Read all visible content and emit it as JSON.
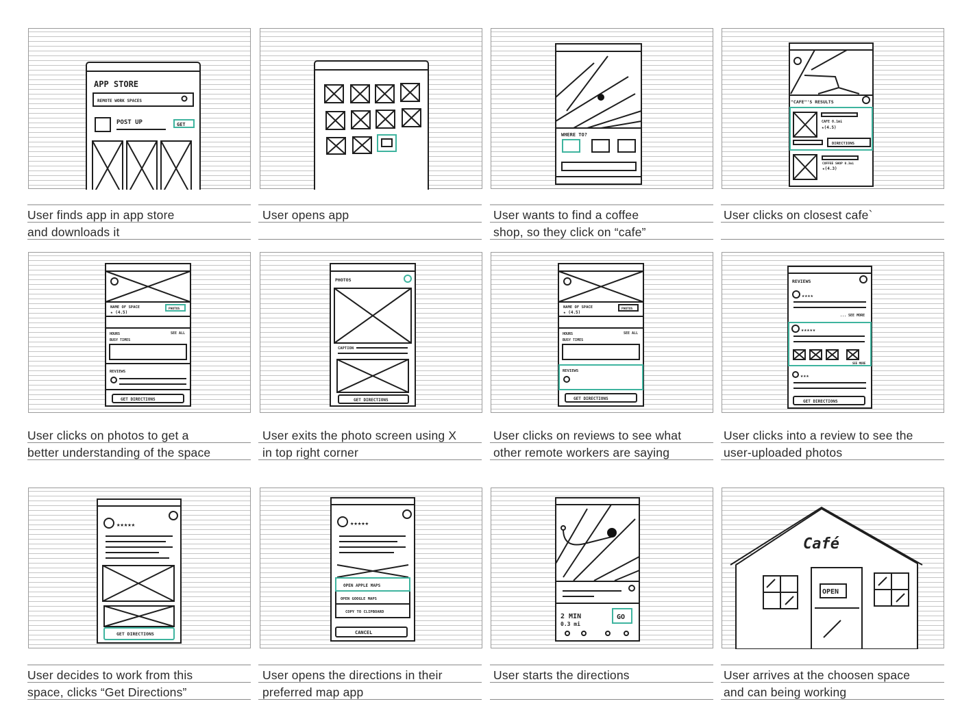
{
  "accent_color": "#3db39e",
  "panels": [
    {
      "caption": [
        "User finds app in app store",
        "and downloads it"
      ],
      "sketch": {
        "title": "APP STORE",
        "search": "REMOTE WORK SPACES",
        "app": "POST UP",
        "button": "GET"
      }
    },
    {
      "caption": [
        "User opens app",
        ""
      ]
    },
    {
      "caption": [
        "User wants to find a coffee",
        "shop, so they click on “cafe”"
      ],
      "sketch": {
        "prompt": "WHERE TO?"
      }
    },
    {
      "caption": [
        "User clicks on closest cafe`",
        ""
      ],
      "sketch": {
        "title": "\"CAFE\"'S RESULTS",
        "r1": "CAFE  0.1mi",
        "r1rating": "★(4.5)",
        "button": "DIRECTIONS",
        "r2": "COFFEE SHOP  0.3mi",
        "r2rating": "★(4.3)"
      }
    },
    {
      "caption": [
        "User clicks on photos to get a",
        "better understanding of the space"
      ],
      "sketch": {
        "name": "NAME OF SPACE",
        "rating": "★ (4.5)",
        "photos": "PHOTOS",
        "hours": "HOURS",
        "seeall": "SEE ALL",
        "busy": "BUSY TIMES",
        "reviews": "REVIEWS",
        "button": "GET DIRECTIONS"
      }
    },
    {
      "caption": [
        "User exits the photo screen using X",
        "in top right corner"
      ],
      "sketch": {
        "title": "PHOTOS",
        "caption": "CAPTION",
        "button": "GET DIRECTIONS"
      }
    },
    {
      "caption": [
        "User clicks on reviews to see what",
        "other remote workers are saying"
      ],
      "sketch": {
        "name": "NAME OF SPACE",
        "rating": "★ (4.5)",
        "photos": "PHOTOS",
        "hours": "HOURS",
        "seeall": "SEE ALL",
        "busy": "BUSY TIMES",
        "reviews": "REVIEWS",
        "button": "GET DIRECTIONS"
      }
    },
    {
      "caption": [
        "User clicks into a review to see the",
        "user-uploaded photos"
      ],
      "sketch": {
        "title": "REVIEWS",
        "more": "... SEE MORE",
        "more2": "SEE MORE",
        "button": "GET DIRECTIONS"
      }
    },
    {
      "caption": [
        "User decides to work from this",
        "space, clicks “Get Directions”"
      ],
      "sketch": {
        "stars": "★★★★★",
        "button": "GET DIRECTIONS"
      }
    },
    {
      "caption": [
        "User opens the directions in their",
        "preferred map app"
      ],
      "sketch": {
        "stars": "★★★★★",
        "o1": "OPEN APPLE MAPS",
        "o2": "OPEN GOOGLE MAPS",
        "o3": "COPY TO CLIPBOARD",
        "cancel": "CANCEL"
      }
    },
    {
      "caption": [
        "User starts the directions",
        ""
      ],
      "sketch": {
        "time": "2 MIN",
        "dist": "0.3 mi",
        "go": "GO"
      }
    },
    {
      "caption": [
        "User arrives at the choosen space",
        "and can being working"
      ],
      "sketch": {
        "sign": "Café",
        "open": "OPEN"
      }
    }
  ]
}
